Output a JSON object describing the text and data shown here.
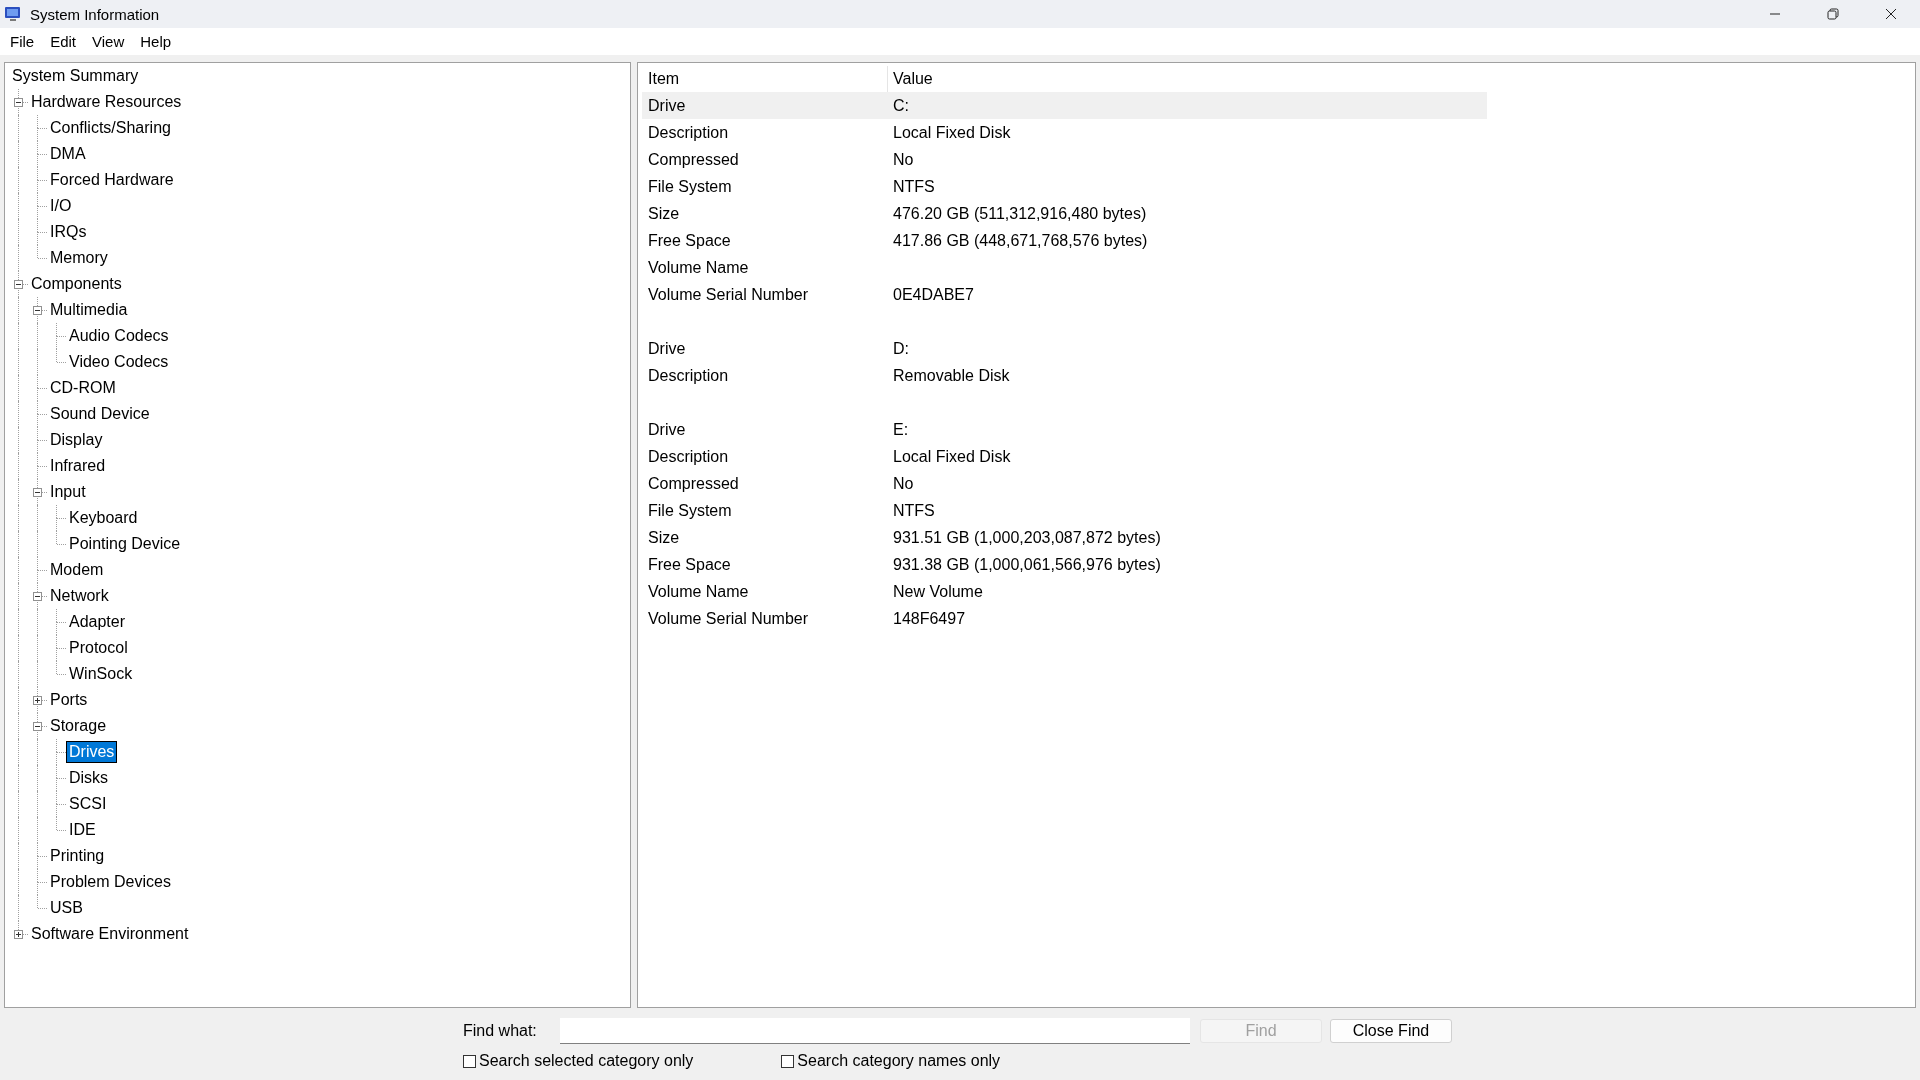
{
  "window": {
    "title": "System Information"
  },
  "menu": [
    "File",
    "Edit",
    "View",
    "Help"
  ],
  "tree": {
    "label": "System Summary",
    "selected": false,
    "children": [
      {
        "label": "Hardware Resources",
        "expanded": true,
        "selected": false,
        "children": [
          {
            "label": "Conflicts/Sharing",
            "selected": false
          },
          {
            "label": "DMA",
            "selected": false
          },
          {
            "label": "Forced Hardware",
            "selected": false
          },
          {
            "label": "I/O",
            "selected": false
          },
          {
            "label": "IRQs",
            "selected": false
          },
          {
            "label": "Memory",
            "selected": false
          }
        ]
      },
      {
        "label": "Components",
        "expanded": true,
        "selected": false,
        "children": [
          {
            "label": "Multimedia",
            "expanded": true,
            "selected": false,
            "children": [
              {
                "label": "Audio Codecs",
                "selected": false
              },
              {
                "label": "Video Codecs",
                "selected": false
              }
            ]
          },
          {
            "label": "CD-ROM",
            "selected": false
          },
          {
            "label": "Sound Device",
            "selected": false
          },
          {
            "label": "Display",
            "selected": false
          },
          {
            "label": "Infrared",
            "selected": false
          },
          {
            "label": "Input",
            "expanded": true,
            "selected": false,
            "children": [
              {
                "label": "Keyboard",
                "selected": false
              },
              {
                "label": "Pointing Device",
                "selected": false
              }
            ]
          },
          {
            "label": "Modem",
            "selected": false
          },
          {
            "label": "Network",
            "expanded": true,
            "selected": false,
            "children": [
              {
                "label": "Adapter",
                "selected": false
              },
              {
                "label": "Protocol",
                "selected": false
              },
              {
                "label": "WinSock",
                "selected": false
              }
            ]
          },
          {
            "label": "Ports",
            "expanded": false,
            "selected": false
          },
          {
            "label": "Storage",
            "expanded": true,
            "selected": false,
            "children": [
              {
                "label": "Drives",
                "selected": true
              },
              {
                "label": "Disks",
                "selected": false
              },
              {
                "label": "SCSI",
                "selected": false
              },
              {
                "label": "IDE",
                "selected": false
              }
            ]
          },
          {
            "label": "Printing",
            "selected": false
          },
          {
            "label": "Problem Devices",
            "selected": false
          },
          {
            "label": "USB",
            "selected": false
          }
        ]
      },
      {
        "label": "Software Environment",
        "expanded": false,
        "selected": false
      }
    ]
  },
  "table": {
    "columns": [
      "Item",
      "Value"
    ],
    "groups": [
      {
        "rows": [
          {
            "item": "Drive",
            "value": "C:",
            "selected": true
          },
          {
            "item": "Description",
            "value": "Local Fixed Disk",
            "selected": false
          },
          {
            "item": "Compressed",
            "value": "No",
            "selected": false
          },
          {
            "item": "File System",
            "value": "NTFS",
            "selected": false
          },
          {
            "item": "Size",
            "value": "476.20 GB (511,312,916,480 bytes)",
            "selected": false
          },
          {
            "item": "Free Space",
            "value": "417.86 GB (448,671,768,576 bytes)",
            "selected": false
          },
          {
            "item": "Volume Name",
            "selected": false
          },
          {
            "item": "Volume Serial Number",
            "value": "0E4DABE7",
            "selected": false
          }
        ]
      },
      {
        "rows": [
          {
            "item": "Drive",
            "value": "D:",
            "selected": false
          },
          {
            "item": "Description",
            "value": "Removable Disk",
            "selected": false
          }
        ]
      },
      {
        "rows": [
          {
            "item": "Drive",
            "value": "E:",
            "selected": false
          },
          {
            "item": "Description",
            "value": "Local Fixed Disk",
            "selected": false
          },
          {
            "item": "Compressed",
            "value": "No",
            "selected": false
          },
          {
            "item": "File System",
            "value": "NTFS",
            "selected": false
          },
          {
            "item": "Size",
            "value": "931.51 GB (1,000,203,087,872 bytes)",
            "selected": false
          },
          {
            "item": "Free Space",
            "value": "931.38 GB (1,000,061,566,976 bytes)",
            "selected": false
          },
          {
            "item": "Volume Name",
            "value": "New Volume",
            "selected": false
          },
          {
            "item": "Volume Serial Number",
            "value": "148F6497",
            "selected": false
          }
        ]
      }
    ]
  },
  "find": {
    "label": "Find what:",
    "find_button": {
      "label": "Find",
      "disabled": true
    },
    "close_button": "Close Find",
    "options": [
      {
        "label": "Search selected category only",
        "checked": false
      },
      {
        "label": "Search category names only",
        "checked": false
      }
    ]
  }
}
